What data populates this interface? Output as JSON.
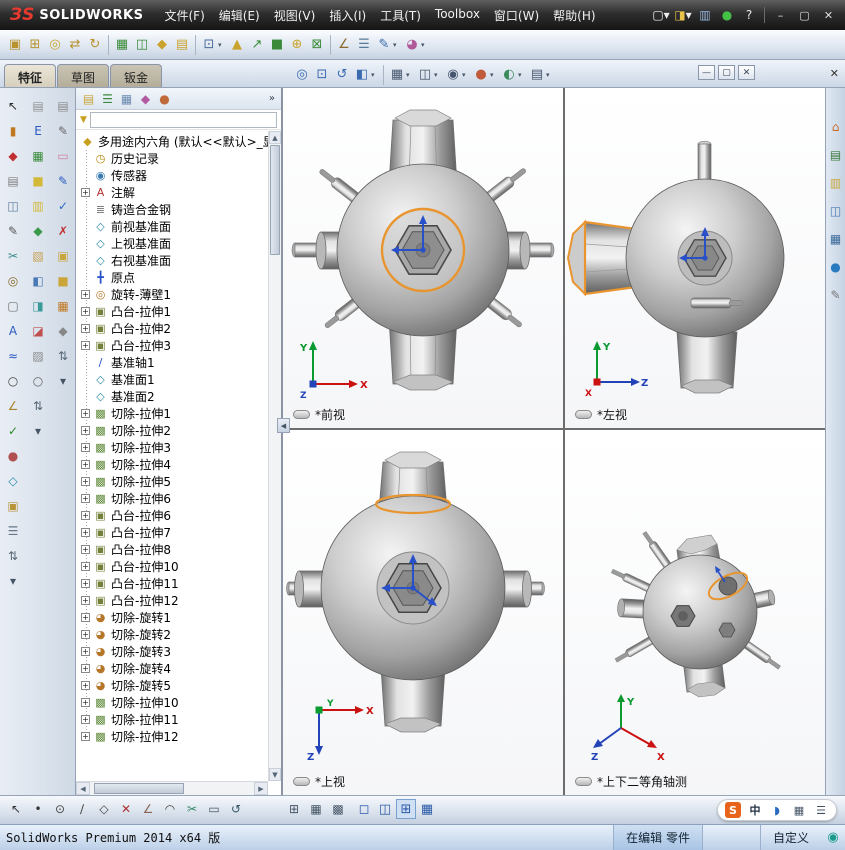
{
  "titlebar": {
    "logo_mark": "ЗS",
    "brand": "SOLIDWORKS",
    "menus": [
      {
        "label": "文件(F)"
      },
      {
        "label": "编辑(E)"
      },
      {
        "label": "视图(V)"
      },
      {
        "label": "插入(I)"
      },
      {
        "label": "工具(T)"
      },
      {
        "label": "Toolbox"
      },
      {
        "label": "窗口(W)"
      },
      {
        "label": "帮助(H)"
      }
    ],
    "quick_icons": [
      {
        "name": "new-document-icon",
        "glyph": "▢",
        "color": "#f0f0f0",
        "caret": "▾"
      },
      {
        "name": "open-icon",
        "glyph": "◨",
        "color": "#e8c24a",
        "caret": "▾"
      },
      {
        "name": "save-icon",
        "glyph": "▥",
        "color": "#9ab8e0"
      },
      {
        "name": "status-light-icon",
        "glyph": "●",
        "color": "#44c044"
      },
      {
        "name": "help-icon",
        "glyph": "?",
        "color": "#e8e8e8"
      }
    ],
    "window_buttons": [
      {
        "name": "minimize-button",
        "glyph": "–"
      },
      {
        "name": "maximize-button",
        "glyph": "▢"
      },
      {
        "name": "close-button",
        "glyph": "✕"
      }
    ]
  },
  "toolbar": {
    "icons": [
      {
        "name": "edit-component-icon",
        "glyph": "▣",
        "color": "#b8922e"
      },
      {
        "name": "insert-component-icon",
        "glyph": "⊞",
        "color": "#b8922e"
      },
      {
        "name": "mate-icon",
        "glyph": "◎",
        "color": "#caa32e"
      },
      {
        "name": "move-component-icon",
        "glyph": "⇄",
        "color": "#b8922e"
      },
      {
        "name": "rotate-component-icon",
        "glyph": "↻",
        "color": "#b8922e"
      },
      {
        "name": "separator",
        "sep": true
      },
      {
        "name": "linear-pattern-icon",
        "glyph": "▦",
        "color": "#3a8a3a"
      },
      {
        "name": "mirror-components-icon",
        "glyph": "◫",
        "color": "#3a8a3a"
      },
      {
        "name": "smart-fasteners-icon",
        "glyph": "◆",
        "color": "#caa32e"
      },
      {
        "name": "assembly-features-icon",
        "glyph": "▤",
        "color": "#caa32e"
      },
      {
        "name": "separator",
        "sep": true
      },
      {
        "name": "reference-geometry-icon",
        "glyph": "⊡",
        "color": "#4a6a9a",
        "caret": "▾"
      },
      {
        "name": "instant-3d-icon",
        "glyph": "▲",
        "color": "#caa32e"
      },
      {
        "name": "rebuild-icon",
        "glyph": "↗",
        "color": "#3a8a3a"
      },
      {
        "name": "component-pattern-icon",
        "glyph": "■",
        "color": "#3a8a3a"
      },
      {
        "name": "exploded-view-icon",
        "glyph": "⊕",
        "color": "#caa32e"
      },
      {
        "name": "interference-check-icon",
        "glyph": "⊠",
        "color": "#3a8a3a"
      },
      {
        "name": "separator",
        "sep": true
      },
      {
        "name": "measure-icon",
        "glyph": "∠",
        "color": "#8a6a2a"
      },
      {
        "name": "mass-properties-icon",
        "glyph": "☰",
        "color": "#5a7a9a"
      },
      {
        "name": "sketch-dropdown-icon",
        "glyph": "✎",
        "color": "#3a6aaa",
        "caret": "▾"
      },
      {
        "name": "appearance-dropdown-icon",
        "glyph": "◕",
        "color": "#b05a9a",
        "caret": "▾"
      }
    ]
  },
  "tabs": [
    {
      "label": "特征",
      "active": true
    },
    {
      "label": "草图",
      "active": false
    },
    {
      "label": "钣金",
      "active": false
    }
  ],
  "headsup": {
    "icons": [
      {
        "name": "zoom-fit-icon",
        "glyph": "◎",
        "color": "#3a6ab0"
      },
      {
        "name": "zoom-area-icon",
        "glyph": "⊡",
        "color": "#3a6ab0"
      },
      {
        "name": "previous-view-icon",
        "glyph": "↺",
        "color": "#3a6ab0"
      },
      {
        "name": "section-view-icon",
        "glyph": "◧",
        "color": "#3a6ab0",
        "caret": "▾"
      },
      {
        "name": "separator",
        "sep": true
      },
      {
        "name": "view-orientation-icon",
        "glyph": "▦",
        "color": "#46566e",
        "caret": "▾"
      },
      {
        "name": "display-style-icon",
        "glyph": "◫",
        "color": "#46566e",
        "caret": "▾"
      },
      {
        "name": "hide-show-icon",
        "glyph": "◉",
        "color": "#46566e",
        "caret": "▾"
      },
      {
        "name": "edit-appearance-icon",
        "glyph": "●",
        "color": "#c05a3a",
        "caret": "▾"
      },
      {
        "name": "apply-scene-icon",
        "glyph": "◐",
        "color": "#3a8a5a",
        "caret": "▾"
      },
      {
        "name": "view-settings-icon",
        "glyph": "▤",
        "color": "#46566e",
        "caret": "▾"
      }
    ]
  },
  "doc_window_buttons": [
    {
      "name": "doc-minimize-button",
      "glyph": "—"
    },
    {
      "name": "doc-restore-button",
      "glyph": "▢"
    },
    {
      "name": "doc-close-button",
      "glyph": "✕"
    }
  ],
  "left_toolbar_a": {
    "icons": [
      {
        "name": "select-icon",
        "glyph": "↖",
        "color": "#2a2a2a"
      },
      {
        "name": "sketch-entities-icon",
        "glyph": "▮",
        "color": "#c07820"
      },
      {
        "name": "dimension-icon",
        "glyph": "◆",
        "color": "#c03030"
      },
      {
        "name": "copy-icon",
        "glyph": "▤",
        "color": "#808080"
      },
      {
        "name": "mirror-icon",
        "glyph": "◫",
        "color": "#5a7a9a"
      },
      {
        "name": "pencil-icon",
        "glyph": "✎",
        "color": "#555555"
      },
      {
        "name": "trim-icon",
        "glyph": "✂",
        "color": "#3a8a8a"
      },
      {
        "name": "convert-entities-icon",
        "glyph": "◎",
        "color": "#886a2a"
      },
      {
        "name": "offset-icon",
        "glyph": "▢",
        "color": "#707070"
      },
      {
        "name": "text-icon",
        "glyph": "A",
        "color": "#2a5ac0"
      },
      {
        "name": "spline-icon",
        "glyph": "≈",
        "color": "#2a5ac0"
      },
      {
        "name": "circle-tool-icon",
        "glyph": "○",
        "color": "#444444"
      },
      {
        "name": "angle-icon",
        "glyph": "∠",
        "color": "#a8862a"
      },
      {
        "name": "check-icon",
        "glyph": "✓",
        "color": "#2a8a2a"
      },
      {
        "name": "appearance-ball-icon",
        "glyph": "●",
        "color": "#b05050"
      },
      {
        "name": "plane-icon",
        "glyph": "◇",
        "color": "#2a8aa8"
      },
      {
        "name": "library-icon",
        "glyph": "▣",
        "color": "#b8953a"
      },
      {
        "name": "list-icon",
        "glyph": "☰",
        "color": "#667788"
      },
      {
        "name": "scroll-icon",
        "glyph": "⇅",
        "color": "#556677"
      },
      {
        "name": "more-tools-icon",
        "glyph": "▾",
        "color": "#445566"
      }
    ]
  },
  "left_toolbar_b": {
    "icons": [
      {
        "name": "new-doc-icon",
        "glyph": "▤",
        "color": "#909090"
      },
      {
        "name": "edit-color-icon",
        "glyph": "E",
        "color": "#2a5ac0"
      },
      {
        "name": "table-icon",
        "glyph": "▦",
        "color": "#3a8a3a"
      },
      {
        "name": "yellow-block-icon",
        "glyph": "■",
        "color": "#d4b838"
      },
      {
        "name": "yellow-grid-icon",
        "glyph": "▥",
        "color": "#d4b838"
      },
      {
        "name": "green-diamond-icon",
        "glyph": "◆",
        "color": "#3a9a4a"
      },
      {
        "name": "tan-hatch-icon",
        "glyph": "▧",
        "color": "#c8a050"
      },
      {
        "name": "blue-half-icon",
        "glyph": "◧",
        "color": "#4a7ab5"
      },
      {
        "name": "teal-half-icon",
        "glyph": "◨",
        "color": "#3a9a9a"
      },
      {
        "name": "red-corner-icon",
        "glyph": "◪",
        "color": "#c05050"
      },
      {
        "name": "gray-hatch-icon",
        "glyph": "▨",
        "color": "#8a8a8a"
      },
      {
        "name": "circle-small-icon",
        "glyph": "○",
        "color": "#666666"
      },
      {
        "name": "swap-icon",
        "glyph": "⇅",
        "color": "#556677"
      },
      {
        "name": "more-icon",
        "glyph": "▾",
        "color": "#445566"
      }
    ]
  },
  "left_toolbar_c": {
    "icons": [
      {
        "name": "document-icon",
        "glyph": "▤",
        "color": "#8a8a8a"
      },
      {
        "name": "annotation-pencil-icon",
        "glyph": "✎",
        "color": "#666666"
      },
      {
        "name": "eraser-icon",
        "glyph": "▭",
        "color": "#d080a0"
      },
      {
        "name": "blue-pencil-icon",
        "glyph": "✎",
        "color": "#2a5ac0"
      },
      {
        "name": "check-blue-icon",
        "glyph": "✓",
        "color": "#2a6ac0"
      },
      {
        "name": "cross-red-icon",
        "glyph": "✗",
        "color": "#c03030"
      },
      {
        "name": "gold-block-icon",
        "glyph": "▣",
        "color": "#caa53a"
      },
      {
        "name": "gold-square-icon",
        "glyph": "■",
        "color": "#caa53a"
      },
      {
        "name": "orange-grid-icon",
        "glyph": "▦",
        "color": "#c07820"
      },
      {
        "name": "gray-diamond-icon",
        "glyph": "◆",
        "color": "#888888"
      },
      {
        "name": "swap2-icon",
        "glyph": "⇅",
        "color": "#556677"
      },
      {
        "name": "more2-icon",
        "glyph": "▾",
        "color": "#445566"
      }
    ]
  },
  "panel": {
    "header_icons": [
      {
        "name": "featuremanager-tab-icon",
        "glyph": "▤",
        "color": "#caa53a"
      },
      {
        "name": "propertymanager-tab-icon",
        "glyph": "☰",
        "color": "#3a8a3a"
      },
      {
        "name": "configurationmanager-tab-icon",
        "glyph": "▦",
        "color": "#6a8ab0"
      },
      {
        "name": "dimxpertmanager-tab-icon",
        "glyph": "◆",
        "color": "#b05aa0"
      },
      {
        "name": "displaymanager-tab-icon",
        "glyph": "●",
        "color": "#c06a3a"
      }
    ],
    "overflow_glyph": "»",
    "collapse_glyph": "◀",
    "filter": {
      "placeholder": "",
      "funnel_glyph": "▼"
    },
    "tree": {
      "root": {
        "label": "多用途内六角 (默认<<默认>_显",
        "glyph": "◆"
      },
      "items": [
        {
          "label": "历史记录",
          "glyph": "◷",
          "color": "#b8860b",
          "exp": ""
        },
        {
          "label": "传感器",
          "glyph": "◉",
          "color": "#3a7ab0",
          "exp": ""
        },
        {
          "label": "注解",
          "glyph": "A",
          "color": "#b03030",
          "exp": "+"
        },
        {
          "label": "铸造合金钢",
          "glyph": "≣",
          "color": "#707070",
          "exp": ""
        },
        {
          "label": "前视基准面",
          "glyph": "◇",
          "color": "#2a8aa8",
          "exp": ""
        },
        {
          "label": "上视基准面",
          "glyph": "◇",
          "color": "#2a8aa8",
          "exp": ""
        },
        {
          "label": "右视基准面",
          "glyph": "◇",
          "color": "#2a8aa8",
          "exp": ""
        },
        {
          "label": "原点",
          "glyph": "╋",
          "color": "#2850c8",
          "exp": ""
        },
        {
          "label": "旋转-薄壁1",
          "glyph": "◎",
          "color": "#b5762a",
          "exp": "+"
        },
        {
          "label": "凸台-拉伸1",
          "glyph": "▣",
          "color": "#73803a",
          "exp": "+"
        },
        {
          "label": "凸台-拉伸2",
          "glyph": "▣",
          "color": "#73803a",
          "exp": "+"
        },
        {
          "label": "凸台-拉伸3",
          "glyph": "▣",
          "color": "#73803a",
          "exp": "+"
        },
        {
          "label": "基准轴1",
          "glyph": "∕",
          "color": "#2850c8",
          "exp": ""
        },
        {
          "label": "基准面1",
          "glyph": "◇",
          "color": "#2a8aa8",
          "exp": ""
        },
        {
          "label": "基准面2",
          "glyph": "◇",
          "color": "#2a8aa8",
          "exp": ""
        },
        {
          "label": "切除-拉伸1",
          "glyph": "▩",
          "color": "#5f8a3a",
          "exp": "+"
        },
        {
          "label": "切除-拉伸2",
          "glyph": "▩",
          "color": "#5f8a3a",
          "exp": "+"
        },
        {
          "label": "切除-拉伸3",
          "glyph": "▩",
          "color": "#5f8a3a",
          "exp": "+"
        },
        {
          "label": "切除-拉伸4",
          "glyph": "▩",
          "color": "#5f8a3a",
          "exp": "+"
        },
        {
          "label": "切除-拉伸5",
          "glyph": "▩",
          "color": "#5f8a3a",
          "exp": "+"
        },
        {
          "label": "切除-拉伸6",
          "glyph": "▩",
          "color": "#5f8a3a",
          "exp": "+"
        },
        {
          "label": "凸台-拉伸6",
          "glyph": "▣",
          "color": "#73803a",
          "exp": "+"
        },
        {
          "label": "凸台-拉伸7",
          "glyph": "▣",
          "color": "#73803a",
          "exp": "+"
        },
        {
          "label": "凸台-拉伸8",
          "glyph": "▣",
          "color": "#73803a",
          "exp": "+"
        },
        {
          "label": "凸台-拉伸10",
          "glyph": "▣",
          "color": "#73803a",
          "exp": "+"
        },
        {
          "label": "凸台-拉伸11",
          "glyph": "▣",
          "color": "#73803a",
          "exp": "+"
        },
        {
          "label": "凸台-拉伸12",
          "glyph": "▣",
          "color": "#73803a",
          "exp": "+"
        },
        {
          "label": "切除-旋转1",
          "glyph": "◕",
          "color": "#b5762a",
          "exp": "+"
        },
        {
          "label": "切除-旋转2",
          "glyph": "◕",
          "color": "#b5762a",
          "exp": "+"
        },
        {
          "label": "切除-旋转3",
          "glyph": "◕",
          "color": "#b5762a",
          "exp": "+"
        },
        {
          "label": "切除-旋转4",
          "glyph": "◕",
          "color": "#b5762a",
          "exp": "+"
        },
        {
          "label": "切除-旋转5",
          "glyph": "◕",
          "color": "#b5762a",
          "exp": "+"
        },
        {
          "label": "切除-拉伸10",
          "glyph": "▩",
          "color": "#5f8a3a",
          "exp": "+"
        },
        {
          "label": "切除-拉伸11",
          "glyph": "▩",
          "color": "#5f8a3a",
          "exp": "+"
        },
        {
          "label": "切除-拉伸12",
          "glyph": "▩",
          "color": "#5f8a3a",
          "exp": "+"
        }
      ]
    }
  },
  "viewports": {
    "front": {
      "label": "*前视"
    },
    "left": {
      "label": "*左视"
    },
    "top": {
      "label": "*上视"
    },
    "iso": {
      "label": "*上下二等角轴测"
    }
  },
  "axis": {
    "x": "X",
    "y": "Y",
    "z": "Z"
  },
  "taskpane": {
    "close_glyph": "✕",
    "icons": [
      {
        "name": "home-icon",
        "glyph": "⌂",
        "color": "#c86a2a"
      },
      {
        "name": "resources-icon",
        "glyph": "▤",
        "color": "#3a7a3a"
      },
      {
        "name": "design-library-icon",
        "glyph": "▥",
        "color": "#caa53a"
      },
      {
        "name": "file-explorer-icon",
        "glyph": "◫",
        "color": "#4a7ab5"
      },
      {
        "name": "view-palette-icon",
        "glyph": "▦",
        "color": "#3a6a9a"
      },
      {
        "name": "appearances-icon",
        "glyph": "●",
        "color": "#2a7ac0"
      },
      {
        "name": "custom-properties-icon",
        "glyph": "✎",
        "color": "#777777"
      }
    ]
  },
  "sketchbar": {
    "icons": [
      {
        "name": "select-icon",
        "glyph": "↖",
        "color": "#333333"
      },
      {
        "name": "sketch-point-icon",
        "glyph": "•",
        "color": "#333333"
      },
      {
        "name": "circle-icon",
        "glyph": "⊙",
        "color": "#444444"
      },
      {
        "name": "line-icon",
        "glyph": "∕",
        "color": "#444444"
      },
      {
        "name": "polygon-icon",
        "glyph": "◇",
        "color": "#444444"
      },
      {
        "name": "delete-icon",
        "glyph": "✕",
        "color": "#aa3333"
      },
      {
        "name": "angle-icon",
        "glyph": "∠",
        "color": "#886655"
      },
      {
        "name": "arc-icon",
        "glyph": "◠",
        "color": "#444444"
      },
      {
        "name": "trim-icon",
        "glyph": "✂",
        "color": "#338866"
      },
      {
        "name": "offset-icon",
        "glyph": "▭",
        "color": "#445566"
      },
      {
        "name": "undo-icon",
        "glyph": "↺",
        "color": "#335566"
      }
    ],
    "center_icons": [
      {
        "name": "snap-grid-icon",
        "glyph": "⊞",
        "color": "#445566"
      },
      {
        "name": "hatch-icon",
        "glyph": "▦",
        "color": "#445566"
      },
      {
        "name": "pattern-icon",
        "glyph": "▩",
        "color": "#445566"
      }
    ],
    "view_buttons": [
      {
        "name": "single-view-button",
        "glyph": "◻",
        "active": false
      },
      {
        "name": "two-view-button",
        "glyph": "◫",
        "active": false
      },
      {
        "name": "four-view-button",
        "glyph": "⊞",
        "active": true
      },
      {
        "name": "grid-view-button",
        "glyph": "▦",
        "active": false
      }
    ]
  },
  "ime": {
    "items": [
      {
        "name": "sogou-icon",
        "glyph": "S",
        "color": "#ffffff",
        "bg": "#e8641a"
      },
      {
        "name": "chinese-mode-icon",
        "glyph": "中",
        "color": "#223344",
        "bg": ""
      },
      {
        "name": "shape-mode-icon",
        "glyph": "◗",
        "color": "#2a6ac0",
        "bg": ""
      },
      {
        "name": "keyboard-icon",
        "glyph": "▦",
        "color": "#445566",
        "bg": ""
      },
      {
        "name": "ime-tools-icon",
        "glyph": "☰",
        "color": "#445566",
        "bg": ""
      }
    ]
  },
  "statusbar": {
    "left": "SolidWorks Premium 2014 x64 版",
    "mode": "在编辑 零件",
    "custom": "自定义",
    "icon_glyph": "◉"
  }
}
